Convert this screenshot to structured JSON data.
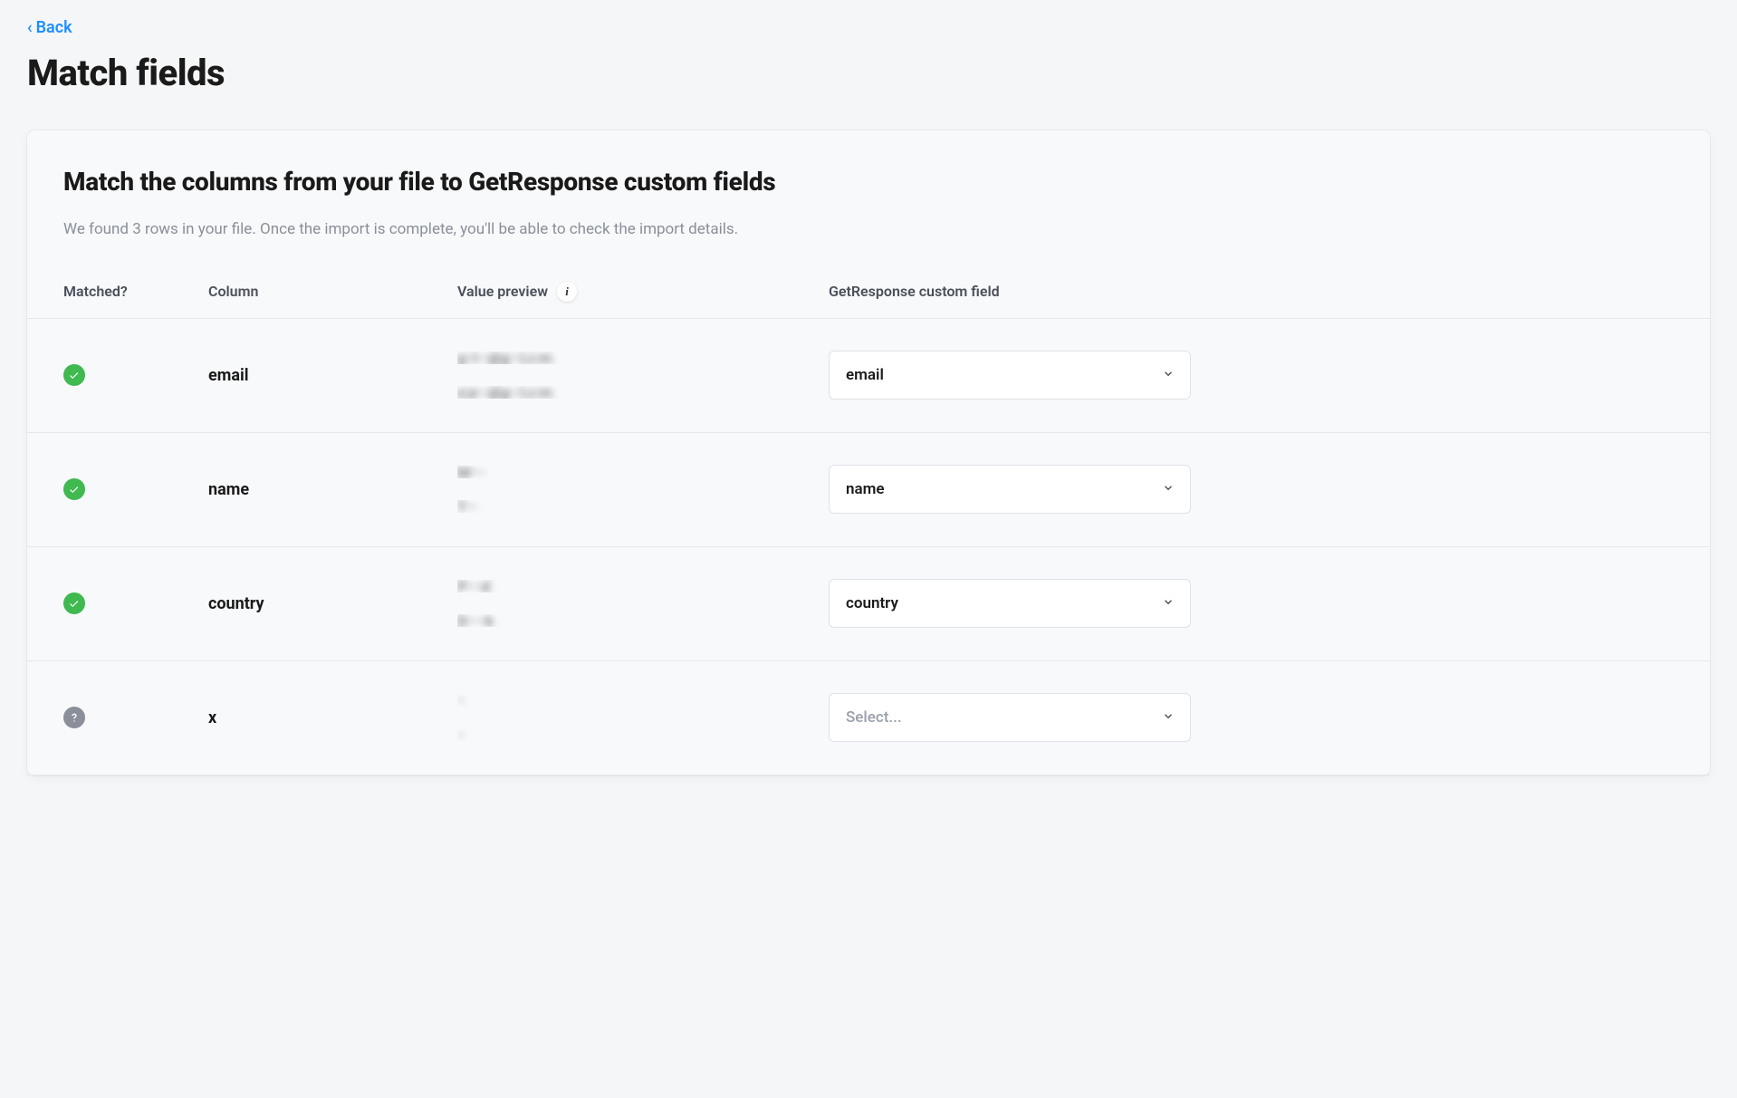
{
  "back_label": "Back",
  "page_title": "Match fields",
  "card": {
    "title": "Match the columns from your file to GetResponse custom fields",
    "subtitle": "We found 3 rows in your file. Once the import is complete, you'll be able to check the import details."
  },
  "headers": {
    "matched": "Matched?",
    "column": "Column",
    "value_preview": "Value preview",
    "custom_field": "GetResponse custom field"
  },
  "select_placeholder": "Select...",
  "rows": [
    {
      "matched": true,
      "column": "email",
      "preview": [
        "g··l···@g···l.c·m",
        "s·p···@g···l.c·m"
      ],
      "selected": "email"
    },
    {
      "matched": true,
      "column": "name",
      "preview": [
        "M····",
        "T···"
      ],
      "selected": "name"
    },
    {
      "matched": true,
      "column": "country",
      "preview": [
        "P····d",
        "D·····k"
      ],
      "selected": "country"
    },
    {
      "matched": false,
      "column": "x",
      "preview": [
        "··",
        "··"
      ],
      "selected": ""
    }
  ]
}
